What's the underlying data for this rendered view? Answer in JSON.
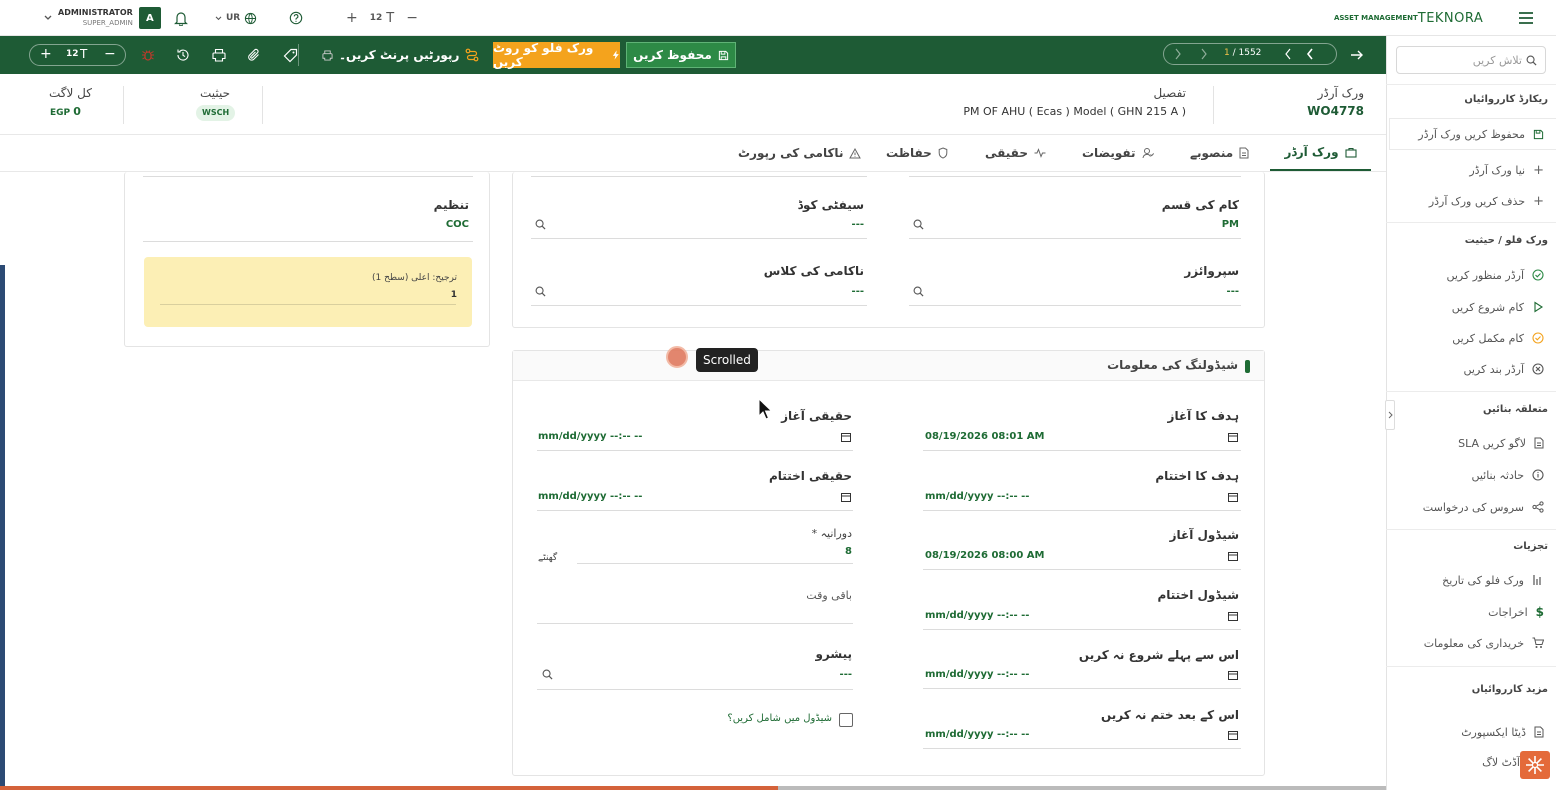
{
  "topbar": {
    "menu_icon": "hamburger-icon",
    "logo_text": "TEKNORA",
    "logo_prefix": "ASSET MANAGEMENT",
    "font_size_label": "12",
    "font_size_letter": "T",
    "lang": "UR",
    "user_name": "ADMINISTRATOR",
    "user_role": "SUPER_ADMIN",
    "avatar_initial": "A"
  },
  "toolbar": {
    "pager_current": "1",
    "pager_total": "1552",
    "save_label": "محفوظ کریں",
    "workflow_route_label": "ورک فلو کو روٹ کریں",
    "print_report_label": "رپورٹیں پرنٹ کریں۔",
    "font_size_label": "12",
    "font_size_letter": "T"
  },
  "header": {
    "wo_label": "ورک آرڈر",
    "wo_number": "WO4778",
    "detail_label": "تفصیل",
    "detail_value": "PM OF AHU  ( Ecas ) Model ( GHN 215 A )",
    "status_label": "حیثیت",
    "status_value": "WSCH",
    "total_cost_label": "کل لاگت",
    "total_cost_currency": "EGP",
    "total_cost_value": "0"
  },
  "tabs": [
    {
      "label": "ورک آرڈر",
      "icon": "briefcase-icon"
    },
    {
      "label": "منصوبے",
      "icon": "document-icon"
    },
    {
      "label": "تفویضات",
      "icon": "user-assign-icon"
    },
    {
      "label": "حقیقی",
      "icon": "pulse-icon"
    },
    {
      "label": "حفاظت",
      "icon": "shield-icon"
    },
    {
      "label": "ناکامی کی رپورٹ",
      "icon": "warning-icon"
    }
  ],
  "sidebar": {
    "search_placeholder": "تلاش کریں",
    "sections": [
      {
        "title": "ریکارڈ کارروائیاں",
        "items": [
          "محفوظ کریں ورک آرڈر",
          "نیا ورک آرڈر",
          "حذف کریں ورک آرڈر"
        ]
      },
      {
        "title": "ورک فلو / حیثیت",
        "items": [
          "آرڈر منظور کریں",
          "کام شروع کریں",
          "کام مکمل کریں",
          "آرڈر بند کریں"
        ]
      },
      {
        "title": "متعلقہ بنائیں",
        "items": [
          "SLA لاگو کریں",
          "حادثہ بنائیں",
          "سروس کی درخواست"
        ]
      },
      {
        "title": "تجزیات",
        "items": [
          "ورک فلو کی تاریخ",
          "اخراجات",
          "خریداری کی معلومات"
        ]
      },
      {
        "title": "مزید کارروائیاں",
        "items": [
          "ڈیٹا ایکسپورٹ",
          "آڈٹ لاگ"
        ]
      }
    ]
  },
  "org_card": {
    "label": "تنظیم",
    "value": "COC",
    "priority_label": "ترجیح: اعلی (سطح 1)",
    "priority_value": "1"
  },
  "fields_card": {
    "work_type_label": "کام کی قسم",
    "work_type_value": "PM",
    "safety_code_label": "سیفٹی کوڈ",
    "safety_code_value": "---",
    "supervisor_label": "سپروائزر",
    "supervisor_value": "---",
    "failure_class_label": "ناکامی کی کلاس",
    "failure_class_value": "---"
  },
  "schedule": {
    "title": "شیڈولنگ کی معلومات",
    "target_start_label": "ہدف کا آغاز",
    "target_start_value": "08/19/2026 08:01 AM",
    "actual_start_label": "حقیقی آغاز",
    "actual_start_value": "mm/dd/yyyy --:-- --",
    "target_end_label": "ہدف کا اختتام",
    "target_end_value": "mm/dd/yyyy --:-- --",
    "actual_end_label": "حقیقی اختتام",
    "actual_end_value": "mm/dd/yyyy --:-- --",
    "schedule_start_label": "شیڈول آغاز",
    "schedule_start_value": "08/19/2026 08:00 AM",
    "duration_label": "* دورانیہ",
    "duration_value": "8",
    "duration_unit": "گھنٹے",
    "schedule_end_label": "شیڈول اختتام",
    "schedule_end_value": "mm/dd/yyyy --:-- --",
    "remaining_label": "باقی وقت",
    "not_start_before_label": "اس سے پہلے شروع نہ کریں",
    "not_start_before_value": "mm/dd/yyyy --:-- --",
    "predecessor_label": "پیشرو",
    "predecessor_value": "---",
    "not_finish_after_label": "اس کے بعد ختم نہ کریں",
    "not_finish_after_value": "mm/dd/yyyy --:-- --",
    "include_in_schedule_label": "شیڈول میں شامل کریں؟"
  },
  "overlay": {
    "tooltip": "Scrolled"
  },
  "colors": {
    "brand_green": "#1e5b35",
    "accent_orange": "#f4a31d",
    "value_green": "#1e6b34",
    "priority_bg": "#fcefb5"
  }
}
